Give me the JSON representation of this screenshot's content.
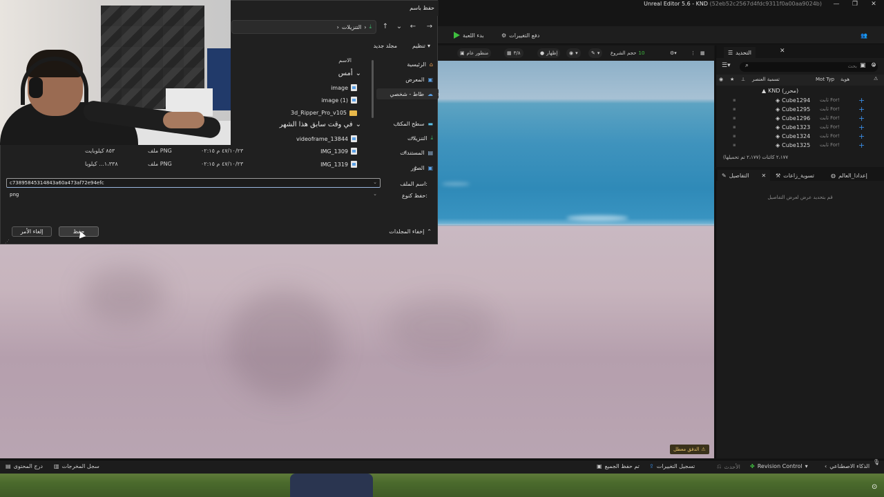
{
  "editor": {
    "title": "Unreal Editor 5.6 - KND",
    "title_hash": "(52eb52c2567d4fdc9311f0a00aa9024b)",
    "toolbar": {
      "play_label": "بدء اللعبة",
      "push_changes_label": "دفع التغييرات"
    },
    "viewport_toolbar": {
      "perspective": "منظور عام",
      "scale": "٣/٨",
      "show": "إظهار",
      "snap_label": "حجم الشروع",
      "snap_value": "10"
    },
    "viewport_warning": "الدفق معطل",
    "outliner": {
      "tab_label": "التحديد",
      "search_placeholder": "بحث",
      "col_label": "تسمية العنصر",
      "col_type": "Mot Typ",
      "col_id": "هوية",
      "root": "KND (محرر)",
      "rows": [
        {
          "name": "Cube1294",
          "type": "ثابت For!"
        },
        {
          "name": "Cube1295",
          "type": "ثابت For!"
        },
        {
          "name": "Cube1296",
          "type": "ثابت For!"
        },
        {
          "name": "Cube1323",
          "type": "ثابت For!"
        },
        {
          "name": "Cube1324",
          "type": "ثابت For!"
        },
        {
          "name": "Cube1325",
          "type": "ثابت For!"
        }
      ],
      "status": "٢،١٧٧ كائنات (٢،١٧٧ تم تحميلها)"
    },
    "details": {
      "tab_details": "التفاصيل",
      "tab_outliner": "تسوية_زاعات",
      "tab_world": "إعدادا_العالم",
      "empty_text": "قم بتحديد عرض لعرض التفاصيل"
    },
    "statusbar": {
      "content_drawer": "درج المحتوى",
      "output_log": "سجل المخرجات",
      "ai": "الذكاء الاصطناعي",
      "revision_control": "Revision Control",
      "recent": "الأحدث",
      "submit": "تسجيل التغييرات",
      "all_saved": "تم حفظ الجميع"
    }
  },
  "dialog": {
    "title": "حفظ باسم",
    "breadcrumb": "التنزيلات",
    "organize": "تنظيم",
    "new_folder": "مجلد جديد",
    "col_name": "الاسم",
    "nav": [
      {
        "label": "الرئيسية"
      },
      {
        "label": "المعرض"
      },
      {
        "label": "طاط - شخصي"
      },
      {
        "label": "سطح المكتب"
      },
      {
        "label": "التنزيلات"
      },
      {
        "label": "المستندات"
      },
      {
        "label": "الصور"
      }
    ],
    "group_yesterday": "أمس",
    "group_earlier": "في وقت سابق هذا الشهر",
    "files_yesterday": [
      {
        "name": "image"
      },
      {
        "name": "image (1)"
      },
      {
        "name": "3d_Ripper_Pro_v105"
      }
    ],
    "files_earlier": [
      {
        "name": "videoframe_13844",
        "date": "",
        "type": "",
        "size": ""
      },
      {
        "name": "IMG_1309",
        "date": "٤٧/١٠/٢٣ م ٠٢:١٥",
        "type": "ملف PNG",
        "size": "٨٥٣ كيلوبايت"
      },
      {
        "name": "IMG_1319",
        "date": "٤٧/١٠/٢٣ م ٠٢:١٥",
        "type": "ملف PNG",
        "size": "١،٣٣٨... كيلوبا"
      }
    ],
    "filename_label": "اسم الملف:",
    "filename_value": "c73895845314843a60a473af72e94efc",
    "savetype_label": "حفظ كنوع:",
    "savetype_value": "png",
    "hide_folders": "إخفاء المجلدات",
    "save_button": "حفظ",
    "cancel_button": "إلغاء الأمر"
  }
}
